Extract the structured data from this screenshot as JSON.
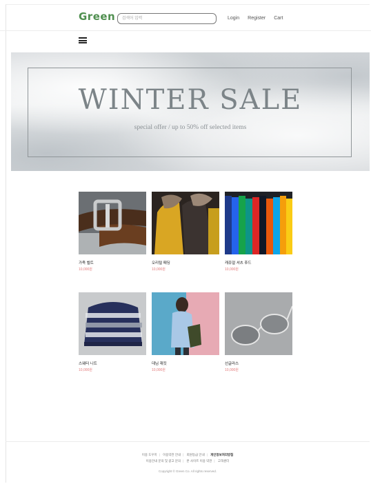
{
  "header": {
    "logo": "Green",
    "search_placeholder": "검색어 입력",
    "nav": [
      "Login",
      "Register",
      "Cart"
    ]
  },
  "banner": {
    "title": "WINTER SALE",
    "subtitle": "special offer / up to 50% off selected items"
  },
  "products": [
    {
      "name": "가죽 벨트",
      "price": "10,000원"
    },
    {
      "name": "오리털 패딩",
      "price": "10,000원"
    },
    {
      "name": "캐쥬얼 셔츠 후드",
      "price": "10,000원"
    },
    {
      "name": "스웨터 니트",
      "price": "10,000원"
    },
    {
      "name": "데님 재킷",
      "price": "10,000원"
    },
    {
      "name": "선글라스",
      "price": "10,000원"
    }
  ],
  "footer": {
    "links_row1": [
      "이용 도우미",
      "이용약관 안내",
      "회원등급 안내",
      "개인정보처리방침"
    ],
    "links_row2": [
      "이용안내 문의 및 광고 문의",
      "본 사이트 이용 약관",
      "고객센터"
    ],
    "copyright": "Copyright © Green Co. All rights reserved."
  }
}
